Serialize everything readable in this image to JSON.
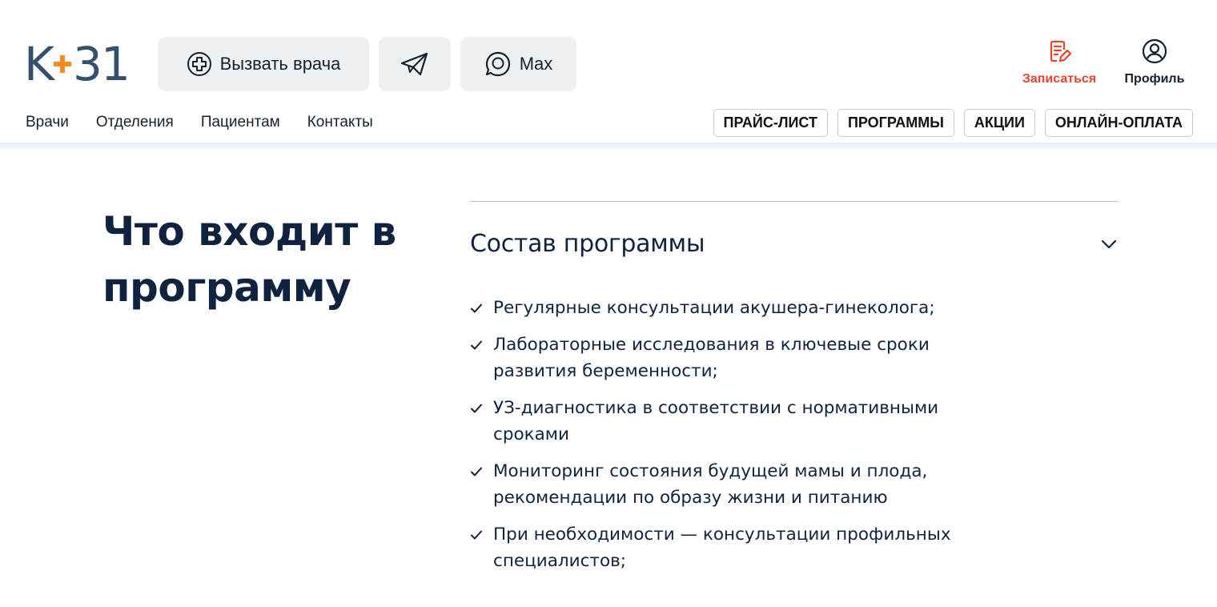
{
  "logo": {
    "left": "K",
    "right": "31"
  },
  "header": {
    "call_doctor": "Вызвать врача",
    "max": "Max",
    "book": "Записаться",
    "profile": "Профиль",
    "telegram_icon": "paper-plane-icon",
    "brand_accent": "#f18b22",
    "book_color": "#e8432b"
  },
  "nav": [
    "Врачи",
    "Отделения",
    "Пациентам",
    "Контакты"
  ],
  "pills": [
    "ПРАЙС-ЛИСТ",
    "ПРОГРАММЫ",
    "АКЦИИ",
    "ОНЛАЙН-ОПЛАТА"
  ],
  "main": {
    "title": "Что входит в программу",
    "accordion": {
      "title": "Состав программы",
      "expanded": true,
      "items": [
        "Регулярные консультации акушера-гинеколога;",
        "Лабораторные исследования в ключевые сроки развития беременности;",
        "УЗ-диагностика в соответствии с нормативными сроками",
        "Мониторинг состояния будущей мамы и плода, рекомендации по образу жизни и питанию",
        "При необходимости — консультации профильных специалистов;"
      ]
    }
  }
}
